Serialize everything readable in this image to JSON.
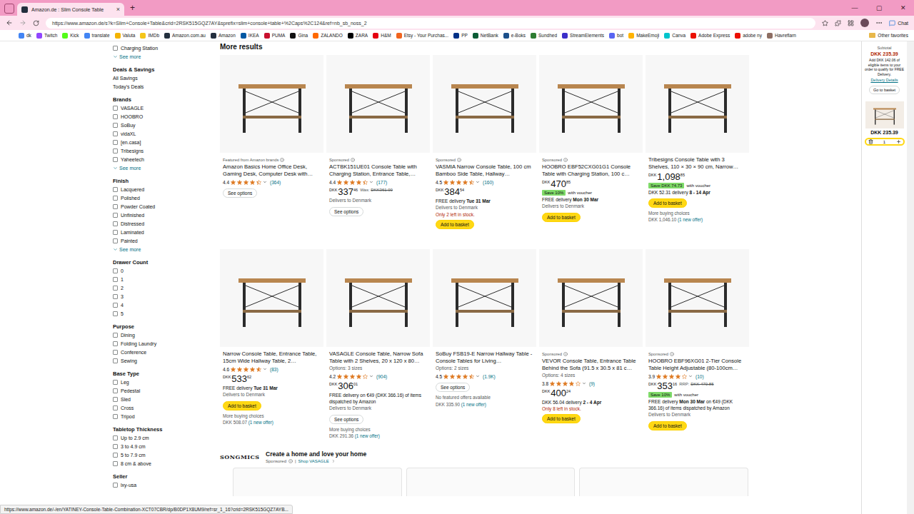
{
  "browser": {
    "tabs": [
      {
        "title": "Amazon.de : Slim Console Table",
        "close": "×",
        "selected": true
      }
    ],
    "new_tab": "+",
    "window_controls": [
      "—",
      "▢",
      "✕"
    ],
    "address": "https://www.amazon.de/s?k=Slim+Console+Table&crid=2RSK515GQZ7AY&sprefix=slim+console+table+%2Caps%2C124&ref=nb_sb_noss_2",
    "chat": "Chat",
    "bookmarks": [
      {
        "label": "dk",
        "color": "#4285f4"
      },
      {
        "label": "Twitch",
        "color": "#9146ff"
      },
      {
        "label": "Kick",
        "color": "#53fc18"
      },
      {
        "label": "translate",
        "color": "#4285f4"
      },
      {
        "label": "Valuta",
        "color": "#f4b400"
      },
      {
        "label": "IMDb",
        "color": "#f5c518"
      },
      {
        "label": "Amazon.com.au",
        "color": "#232f3e"
      },
      {
        "label": "Amazon",
        "color": "#232f3e"
      },
      {
        "label": "IKEA",
        "color": "#0058a3"
      },
      {
        "label": "PUMA",
        "color": "#c8102e"
      },
      {
        "label": "Gina",
        "color": "#111111"
      },
      {
        "label": "ZALANDO",
        "color": "#ff6900"
      },
      {
        "label": "ZARA",
        "color": "#000000"
      },
      {
        "label": "H&M",
        "color": "#e50010"
      },
      {
        "label": "Etsy - Your Purchas...",
        "color": "#f1641e"
      },
      {
        "label": "PP",
        "color": "#003087"
      },
      {
        "label": "NetBank",
        "color": "#0a5c36"
      },
      {
        "label": "e-Boks",
        "color": "#1b4f8a"
      },
      {
        "label": "Sundhed",
        "color": "#2e7d32"
      },
      {
        "label": "StreamElements",
        "color": "#3b2fc9"
      },
      {
        "label": "bot",
        "color": "#5865f2"
      },
      {
        "label": "MakeEmoji",
        "color": "#ffb300"
      },
      {
        "label": "Canva",
        "color": "#00c4cc"
      },
      {
        "label": "Adobe Express",
        "color": "#eb1000"
      },
      {
        "label": "adobe ny",
        "color": "#eb1000"
      },
      {
        "label": "Havreflarn",
        "color": "#8d6e63"
      }
    ],
    "other_favorites": "Other favorites"
  },
  "sidebar": {
    "sections": [
      {
        "items": [
          {
            "label": "Charging Station",
            "kind": "checkbox",
            "checked": false
          }
        ],
        "more": "See more"
      },
      {
        "title": "Deals & Savings",
        "items": [
          {
            "label": "All Savings",
            "kind": "link",
            "checked": false
          },
          {
            "label": "Today's Deals",
            "kind": "link",
            "checked": false
          }
        ]
      },
      {
        "title": "Brands",
        "items": [
          {
            "label": "VASAGLE",
            "kind": "checkbox",
            "checked": false
          },
          {
            "label": "HOOBRO",
            "kind": "checkbox",
            "checked": false
          },
          {
            "label": "SoBuy",
            "kind": "checkbox",
            "checked": false
          },
          {
            "label": "vidaXL",
            "kind": "checkbox",
            "checked": false
          },
          {
            "label": "[en.casa]",
            "kind": "checkbox",
            "checked": false
          },
          {
            "label": "Tribesigns",
            "kind": "checkbox",
            "checked": false
          },
          {
            "label": "Yaheetech",
            "kind": "checkbox",
            "checked": false
          }
        ],
        "more": "See more"
      },
      {
        "title": "Finish",
        "items": [
          {
            "label": "Lacquered",
            "kind": "checkbox",
            "checked": false
          },
          {
            "label": "Polished",
            "kind": "checkbox",
            "checked": false
          },
          {
            "label": "Powder Coated",
            "kind": "checkbox",
            "checked": false
          },
          {
            "label": "Unfinished",
            "kind": "checkbox",
            "checked": false
          },
          {
            "label": "Distressed",
            "kind": "checkbox",
            "checked": false
          },
          {
            "label": "Laminated",
            "kind": "checkbox",
            "checked": false
          },
          {
            "label": "Painted",
            "kind": "checkbox",
            "checked": false
          }
        ],
        "more": "See more"
      },
      {
        "title": "Drawer Count",
        "items": [
          {
            "label": "0",
            "kind": "checkbox",
            "checked": false
          },
          {
            "label": "1",
            "kind": "checkbox",
            "checked": false
          },
          {
            "label": "2",
            "kind": "checkbox",
            "checked": false
          },
          {
            "label": "3",
            "kind": "checkbox",
            "checked": false
          },
          {
            "label": "4",
            "kind": "checkbox",
            "checked": false
          },
          {
            "label": "5",
            "kind": "checkbox",
            "checked": false
          }
        ]
      },
      {
        "title": "Purpose",
        "items": [
          {
            "label": "Dining",
            "kind": "checkbox",
            "checked": false
          },
          {
            "label": "Folding Laundry",
            "kind": "checkbox",
            "checked": false
          },
          {
            "label": "Conference",
            "kind": "checkbox",
            "checked": false
          },
          {
            "label": "Sewing",
            "kind": "checkbox",
            "checked": false
          }
        ]
      },
      {
        "title": "Base Type",
        "items": [
          {
            "label": "Leg",
            "kind": "checkbox",
            "checked": false
          },
          {
            "label": "Pedestal",
            "kind": "checkbox",
            "checked": false
          },
          {
            "label": "Sled",
            "kind": "checkbox",
            "checked": false
          },
          {
            "label": "Cross",
            "kind": "checkbox",
            "checked": false
          },
          {
            "label": "Tripod",
            "kind": "checkbox",
            "checked": false
          }
        ]
      },
      {
        "title": "Tabletop Thickness",
        "items": [
          {
            "label": "Up to 2.9 cm",
            "kind": "checkbox",
            "checked": false
          },
          {
            "label": "3 to 4.9 cm",
            "kind": "checkbox",
            "checked": false
          },
          {
            "label": "5 to 7.9 cm",
            "kind": "checkbox",
            "checked": false
          },
          {
            "label": "8 cm & above",
            "kind": "checkbox",
            "checked": false
          }
        ]
      },
      {
        "title": "Seller",
        "items": [
          {
            "label": "lxy-usa",
            "kind": "checkbox",
            "checked": false
          }
        ]
      }
    ]
  },
  "results": {
    "heading": "More results",
    "products": [
      {
        "label": "Featured from Amazon brands",
        "title": "Amazon Basics Home Office Desk, Gaming Desk, Computer Desk with…",
        "rating": {
          "value": "4.4",
          "stars": 4.4,
          "count": "(364)"
        },
        "button": {
          "label": "See options",
          "kind": "secondary"
        }
      },
      {
        "label": "Sponsored",
        "title": "ACTBK151UE01 Console Table with Charging Station, Entrance Table,…",
        "rating": {
          "value": "4.4",
          "stars": 4.4,
          "count": "(177)"
        },
        "price": {
          "currency": "DKK",
          "whole": "337",
          "fraction": "46"
        },
        "was": {
          "label": "Was:",
          "value": "DKK361.00"
        },
        "ships": "Delivers to Denmark",
        "button": {
          "label": "See options",
          "kind": "secondary"
        }
      },
      {
        "label": "Sponsored",
        "title": "VASMIA Narrow Console Table, 100 cm Bamboo Side Table, Hallway…",
        "rating": {
          "value": "4.5",
          "stars": 4.5,
          "count": "(160)"
        },
        "price": {
          "currency": "DKK",
          "whole": "384",
          "fraction": "54"
        },
        "delivery": {
          "text": "FREE delivery",
          "bold": "Tue 31 Mar"
        },
        "ships": "Delivers to Denmark",
        "stock": "Only 2 left in stock.",
        "button": {
          "label": "Add to basket",
          "kind": "primary"
        }
      },
      {
        "label": "Sponsored",
        "title": "HOOBRO EBF52CXG01G1 Console Table with Charging Station, 100 c…",
        "price": {
          "currency": "DKK",
          "whole": "470",
          "fraction": "85"
        },
        "badge": {
          "text": "Save 10%",
          "note": "with voucher"
        },
        "delivery": {
          "text": "FREE delivery",
          "bold": "Mon 30 Mar"
        },
        "ships": "Delivers to Denmark",
        "button": {
          "label": "Add to basket",
          "kind": "primary"
        }
      },
      {
        "title": "Tribesigns Console Table with 3 Shelves, 110 × 30 × 90 cm, Narrow…",
        "price": {
          "currency": "DKK",
          "whole": "1,098",
          "fraction": "85"
        },
        "badge": {
          "text": "Save DKK 74.73",
          "note": "with voucher"
        },
        "delivery": {
          "text": "DKK 52.31 delivery",
          "bold": "8 - 14 Apr"
        },
        "button": {
          "label": "Add to basket",
          "kind": "primary"
        },
        "more": {
          "label": "More buying choices",
          "price": "DKK 1,046.10",
          "offer": "(1 new offer)"
        }
      },
      {
        "title": "Narrow Console Table, Entrance Table, 15cm Wide Hallway Table, 2…",
        "rating": {
          "value": "4.6",
          "stars": 4.6,
          "count": "(83)"
        },
        "price": {
          "currency": "DKK",
          "whole": "533",
          "fraction": "62"
        },
        "delivery": {
          "text": "FREE delivery",
          "bold": "Tue 31 Mar"
        },
        "ships": "Delivers to Denmark",
        "button": {
          "label": "Add to basket",
          "kind": "primary"
        },
        "more": {
          "label": "More buying choices",
          "price": "DKK 508.07",
          "offer": "(1 new offer)"
        }
      },
      {
        "title": "VASAGLE Console Table, Narrow Sofa Table with 2 Shelves, 20 x 120 x 80…",
        "options": "Options: 3 sizes",
        "rating": {
          "value": "4.2",
          "stars": 4.2,
          "count": "(904)"
        },
        "price": {
          "currency": "DKK",
          "whole": "306",
          "fraction": "01"
        },
        "delivery": {
          "text": "FREE delivery on €49 (DKK 366.16) of items dispatched by Amazon"
        },
        "ships": "Delivers to Denmark",
        "button": {
          "label": "See options",
          "kind": "secondary"
        },
        "more": {
          "label": "More buying choices",
          "price": "DKK 291.36",
          "offer": "(1 new offer)"
        }
      },
      {
        "title": "SoBuy FSB19-E Narrow Hallway Table - Console Tables for Living…",
        "options": "Options: 2 sizes",
        "rating": {
          "value": "4.5",
          "stars": 4.5,
          "count": "(1.9K)"
        },
        "button": {
          "label": "See options",
          "kind": "secondary"
        },
        "no_offers": "No featured offers available",
        "more": {
          "price": "DKK 335.90",
          "offer": "(1 new offer)"
        }
      },
      {
        "label": "Sponsored",
        "title": "VEVOR Console Table, Entrance Table Behind the Sofa (91.5 x 30.5 x 81 c…",
        "options": "Options: 4 sizes",
        "rating": {
          "value": "3.8",
          "stars": 3.8,
          "count": "(9)"
        },
        "price": {
          "currency": "DKK",
          "whole": "400",
          "fraction": "24"
        },
        "delivery": {
          "text": "DKK 56.04 delivery",
          "bold": "2 - 4 Apr"
        },
        "stock": "Only 8 left in stock.",
        "button": {
          "label": "Add to basket",
          "kind": "primary"
        }
      },
      {
        "label": "Sponsored",
        "title": "HOOBRO EBF96XG01 2-Tier Console Table Height Adjustable (80-100cm…",
        "rating": {
          "value": "3.9",
          "stars": 3.9,
          "count": "(10)"
        },
        "price": {
          "currency": "DKK",
          "whole": "353",
          "fraction": "16"
        },
        "was": {
          "label": "RRP:",
          "value": "DKK 470.85"
        },
        "badge": {
          "text": "Save 10%",
          "note": "with voucher"
        },
        "delivery": {
          "text": "FREE delivery",
          "bold": "Mon 30 Mar",
          "tail": "on €49 (DKK 366.16) of items dispatched by Amazon"
        },
        "ships": "Delivers to Denmark",
        "button": {
          "label": "Add to basket",
          "kind": "primary"
        }
      }
    ]
  },
  "brand_banner": {
    "logo": "SONGMICS",
    "headline": "Create a home and love your home",
    "sponsored": "Sponsored",
    "separator": "|",
    "link": "Shop VASAGLE",
    "tiles": 3
  },
  "basket": {
    "subtotal_label": "Subtotal",
    "subtotal": "DKK 235.39",
    "note": "Add DKK 142.06 of eligible items to your order to qualify for FREE Delivery.",
    "link": "Delivery Details",
    "button": "Go to basket",
    "item_price": "DKK 235.39",
    "quantity": "1"
  },
  "status_bar": {
    "url": "https://www.amazon.de/-/en/YATINEY-Console-Table-Combination-XCT07CBR/dp/B0DP1X8UM9/ref=sr_1_16?crid=2RSK515GQZ7AYB..."
  }
}
